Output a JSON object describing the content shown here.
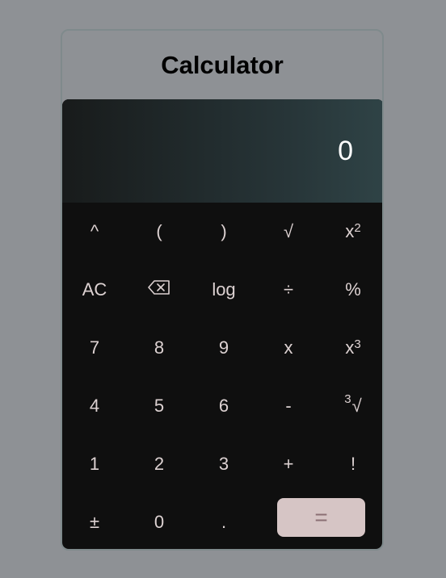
{
  "app": {
    "title": "Calculator"
  },
  "display": {
    "value": "0"
  },
  "keys": {
    "row1": [
      "^",
      "(",
      ")",
      "√",
      "x"
    ],
    "row1_sup": "2",
    "row2": [
      "AC",
      "⌫",
      "log",
      "÷",
      "%"
    ],
    "row3": [
      "7",
      "8",
      "9",
      "x",
      "x"
    ],
    "row3_sup": "3",
    "row4": [
      "4",
      "5",
      "6",
      "-",
      "√"
    ],
    "row4_pre": "3",
    "row5": [
      "1",
      "2",
      "3",
      "+",
      "!"
    ],
    "row6": [
      "±",
      "0",
      "."
    ],
    "equals": "="
  },
  "colors": {
    "background": "#8e9195",
    "keypad": "#0f0f0f",
    "key_text": "#ddd2d2",
    "equals_bg": "#d6c5c5",
    "equals_text": "#8a6f73"
  }
}
